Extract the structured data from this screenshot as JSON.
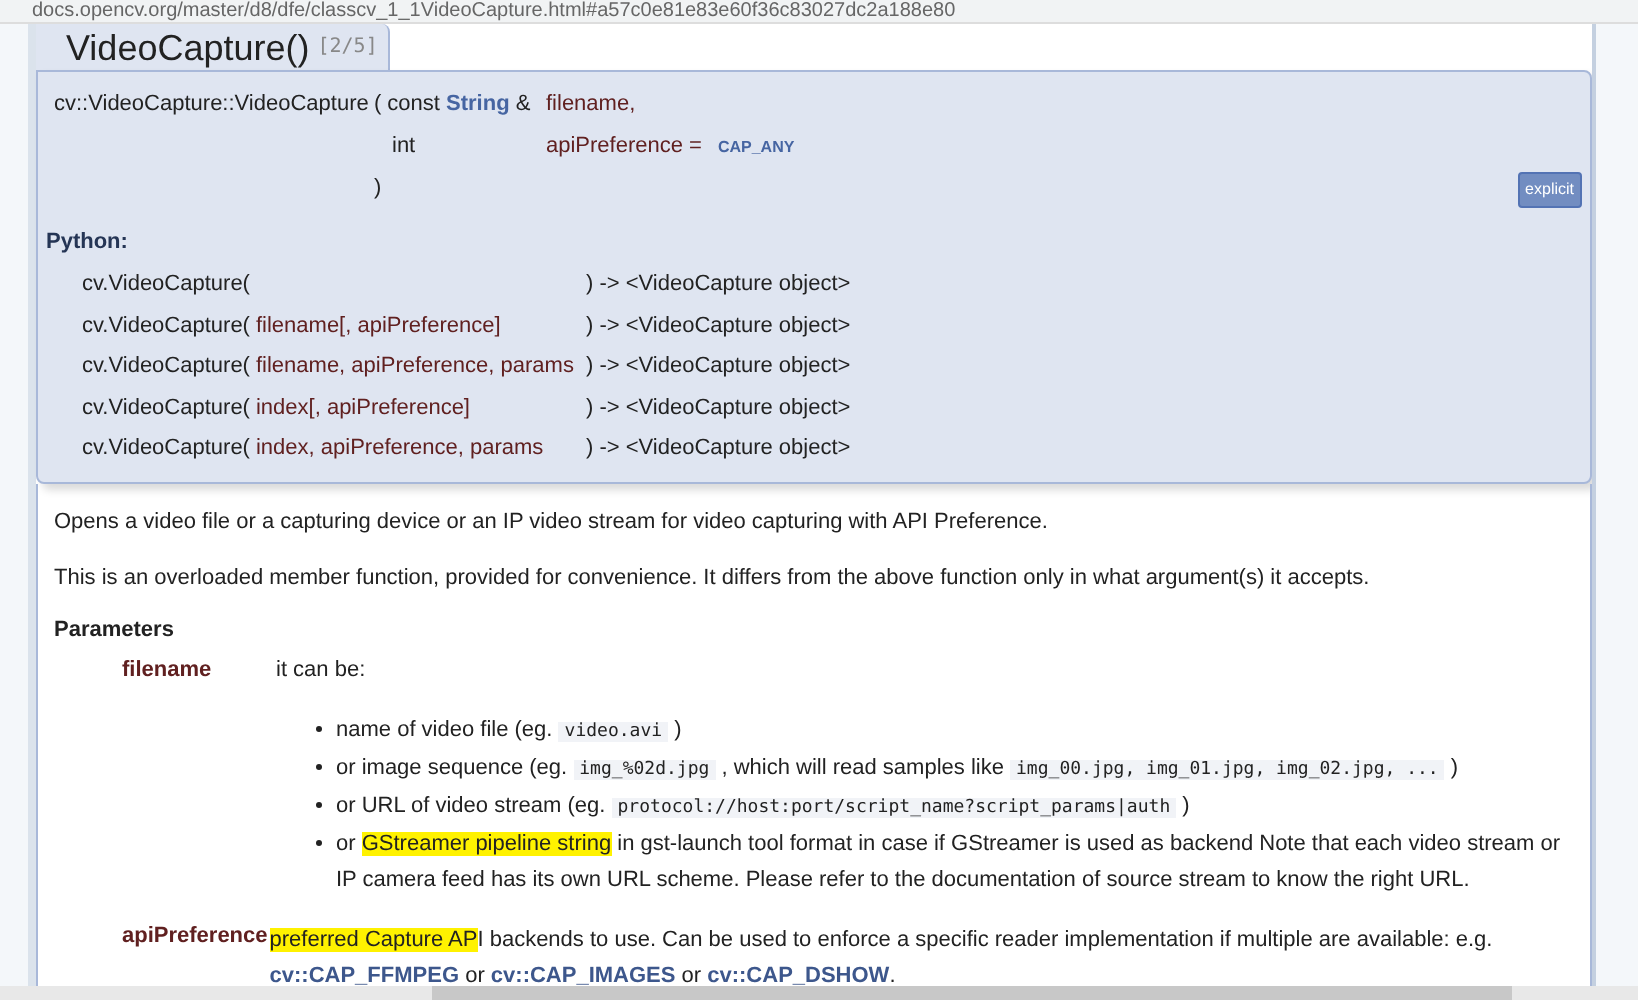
{
  "address_bar": {
    "url": "docs.opencv.org/master/d8/dfe/classcv_1_1VideoCapture.html#a57c0e81e83e60f36c83027dc2a188e80"
  },
  "title": {
    "name": "VideoCapture()",
    "overload": "[2/5]"
  },
  "signature": {
    "function": "cv::VideoCapture::VideoCapture",
    "open": "(",
    "params": [
      {
        "type_prefix": "const ",
        "type": "String",
        "type_suffix": " &",
        "name": "filename,"
      },
      {
        "type_prefix": "int",
        "name": "apiPreference =",
        "default": "CAP_ANY"
      }
    ],
    "close": ")",
    "badge": "explicit"
  },
  "python": {
    "heading": "Python:",
    "rows": [
      {
        "call": "cv.VideoCapture(",
        "args": "",
        "returns": ") -> <VideoCapture object>"
      },
      {
        "call": "cv.VideoCapture(",
        "args": "filename[, apiPreference]",
        "returns": ") -> <VideoCapture object>"
      },
      {
        "call": "cv.VideoCapture(",
        "args": "filename, apiPreference, params",
        "returns": ") -> <VideoCapture object>"
      },
      {
        "call": "cv.VideoCapture(",
        "args": "index[, apiPreference]",
        "returns": ") -> <VideoCapture object>"
      },
      {
        "call": "cv.VideoCapture(",
        "args": "index, apiPreference, params",
        "returns": ") -> <VideoCapture object>"
      }
    ]
  },
  "description": [
    "Opens a video file or a capturing device or an IP video stream for video capturing with API Preference.",
    "This is an overloaded member function, provided for convenience. It differs from the above function only in what argument(s) it accepts."
  ],
  "parameters": {
    "heading": "Parameters",
    "items": [
      {
        "name": "filename",
        "intro": "it can be:",
        "bullets": [
          [
            {
              "kind": "text",
              "text": "name of video file (eg. "
            },
            {
              "kind": "code",
              "text": "video.avi"
            },
            {
              "kind": "text",
              "text": " )"
            }
          ],
          [
            {
              "kind": "text",
              "text": "or image sequence (eg. "
            },
            {
              "kind": "code",
              "text": "img_%02d.jpg"
            },
            {
              "kind": "text",
              "text": " , which will read samples like "
            },
            {
              "kind": "code",
              "text": "img_00.jpg, img_01.jpg, img_02.jpg, ..."
            },
            {
              "kind": "text",
              "text": " )"
            }
          ],
          [
            {
              "kind": "text",
              "text": "or URL of video stream (eg. "
            },
            {
              "kind": "code",
              "text": "protocol://host:port/script_name?script_params|auth"
            },
            {
              "kind": "text",
              "text": " )"
            }
          ],
          [
            {
              "kind": "text",
              "text": "or "
            },
            {
              "kind": "highlight",
              "text": "GStreamer pipeline string"
            },
            {
              "kind": "text",
              "text": " in gst-launch tool format in case if GStreamer is used as backend Note that each video stream or IP camera feed has its own URL scheme. Please refer to the documentation of source stream to know the right URL."
            }
          ]
        ]
      },
      {
        "name": "apiPreference",
        "text": [
          {
            "kind": "highlight",
            "text": "preferred Capture AP"
          },
          {
            "kind": "text",
            "text": "I backends to use. Can be used to enforce a specific reader implementation if multiple are available: e.g. "
          },
          {
            "kind": "link",
            "text": "cv::CAP_FFMPEG"
          },
          {
            "kind": "text",
            "text": " or "
          },
          {
            "kind": "link",
            "text": "cv::CAP_IMAGES"
          },
          {
            "kind": "text",
            "text": " or "
          },
          {
            "kind": "link",
            "text": "cv::CAP_DSHOW"
          },
          {
            "kind": "text",
            "text": "."
          }
        ]
      }
    ]
  }
}
